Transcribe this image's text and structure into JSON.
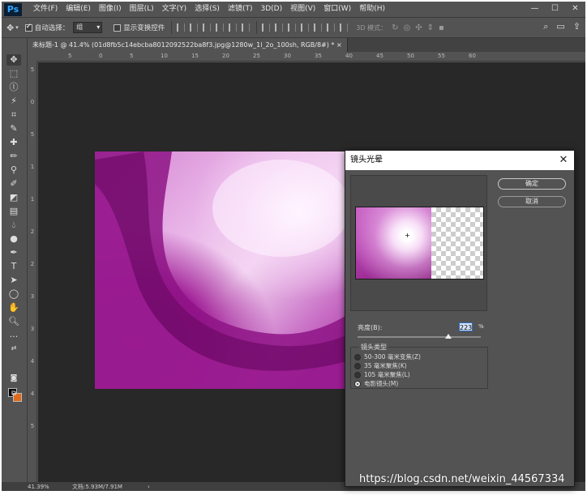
{
  "app": {
    "logo": "Ps",
    "window_controls": [
      "—",
      "☐",
      "✕"
    ]
  },
  "menu": [
    "文件(F)",
    "编辑(E)",
    "图像(I)",
    "图层(L)",
    "文字(Y)",
    "选择(S)",
    "滤镜(T)",
    "3D(D)",
    "视图(V)",
    "窗口(W)",
    "帮助(H)"
  ],
  "options": {
    "auto_select_label": "自动选择：",
    "auto_select_checked": true,
    "auto_select_value": "组",
    "show_transform_label": "显示变换控件",
    "show_transform_checked": false,
    "mode_3d_label": "3D 模式："
  },
  "document": {
    "tab_title": "未标题-1 @ 41.4% (01d8fb5c14ebcba8012092522ba8f3.jpg@1280w_1l_2o_100sh, RGB/8#) *",
    "tab_close": "×"
  },
  "rulers": {
    "top": [
      "5",
      "0",
      "5",
      "10",
      "15",
      "20",
      "25",
      "30",
      "35",
      "40",
      "45",
      "50",
      "55",
      "60"
    ],
    "left": [
      "5",
      "0",
      "5",
      "1",
      "1",
      "2",
      "2",
      "3",
      "3",
      "4",
      "4",
      "5"
    ]
  },
  "status": {
    "zoom": "41.39%",
    "doc": "文档:5.93M/7.91M",
    "arrow": "›"
  },
  "dialog": {
    "title": "镜头光晕",
    "close": "✕",
    "ok": "确定",
    "cancel": "取消",
    "brightness_label": "亮度(B):",
    "brightness_value": "223",
    "brightness_unit": "%",
    "brightness_percent": 223,
    "lens_type_label": "镜头类型",
    "lens_options": [
      {
        "label": "50-300 毫米变焦(Z)",
        "selected": false
      },
      {
        "label": "35 毫米聚焦(K)",
        "selected": false
      },
      {
        "label": "105 毫米聚焦(L)",
        "selected": false
      },
      {
        "label": "电影镜头(M)",
        "selected": true
      }
    ]
  },
  "watermark": "https://blog.csdn.net/weixin_44567334",
  "colors": {
    "foreground": "#000000",
    "background": "#e06a1a",
    "panel": "#535353",
    "canvas": "#282828"
  }
}
